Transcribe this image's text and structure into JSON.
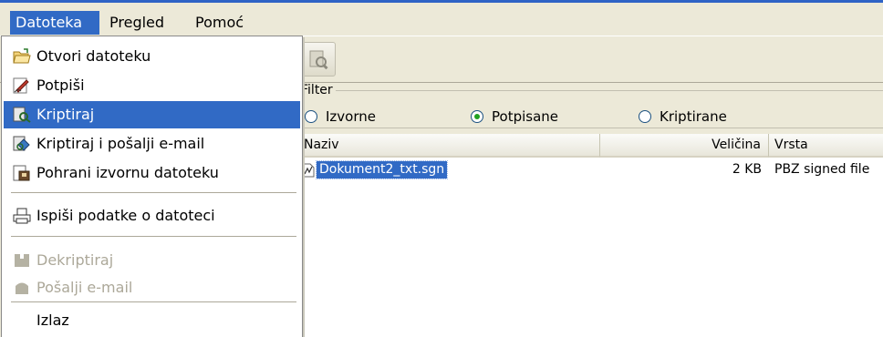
{
  "menubar": {
    "file": "Datoteka",
    "view": "Pregled",
    "help": "Pomoć"
  },
  "file_menu": {
    "open": "Otvori datoteku",
    "sign": "Potpiši",
    "encrypt": "Kriptiraj",
    "encrypt_send": "Kriptiraj i pošalji e-mail",
    "save_original": "Pohrani izvornu datoteku",
    "print_info": "Ispiši podatke o datoteci",
    "decrypt": "Dekriptiraj",
    "send_email": "Pošalji e-mail",
    "exit": "Izlaz"
  },
  "filter": {
    "title": "Filter",
    "options": [
      "Izvorne",
      "Potpisane",
      "Kriptirane"
    ],
    "selected": "Potpisane"
  },
  "list": {
    "columns": [
      "Naziv",
      "Veličina",
      "Vrsta"
    ],
    "rows": [
      {
        "name": "Dokument2_txt.sgn",
        "size": "2 KB",
        "type": "PBZ signed file"
      }
    ]
  },
  "colors": {
    "highlight": "#316ac5",
    "background": "#ece9d8",
    "disabled_text": "#aca899"
  }
}
